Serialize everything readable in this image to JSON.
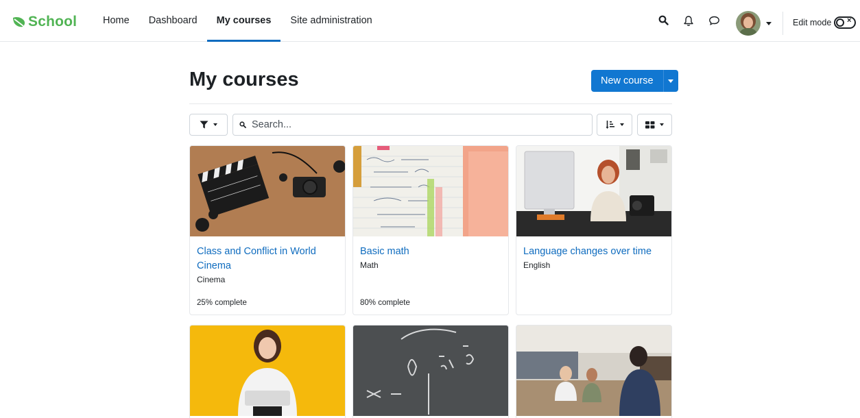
{
  "brand": {
    "name": "School",
    "color": "#51b454"
  },
  "nav": {
    "links": [
      "Home",
      "Dashboard",
      "My courses",
      "Site administration"
    ],
    "active": "My courses",
    "edit_mode_label": "Edit mode"
  },
  "page": {
    "title": "My courses",
    "new_course_label": "New course",
    "search_placeholder": "Search..."
  },
  "courses": [
    {
      "title": "Class and Conflict in World Cinema",
      "category": "Cinema",
      "progress": "25% complete",
      "image": "film-clapperboard-camera"
    },
    {
      "title": "Basic math",
      "category": "Math",
      "progress": "80% complete",
      "image": "math-notes"
    },
    {
      "title": "Language changes over time",
      "category": "English",
      "progress": "",
      "image": "teacher-at-computer"
    },
    {
      "title": "",
      "category": "",
      "progress": "",
      "image": "student-yellow-background"
    },
    {
      "title": "",
      "category": "",
      "progress": "",
      "image": "chalkboard-equations"
    },
    {
      "title": "",
      "category": "",
      "progress": "",
      "image": "library-classroom"
    }
  ],
  "colors": {
    "accent": "#0f6cbf",
    "primary_button": "#1177d1"
  }
}
